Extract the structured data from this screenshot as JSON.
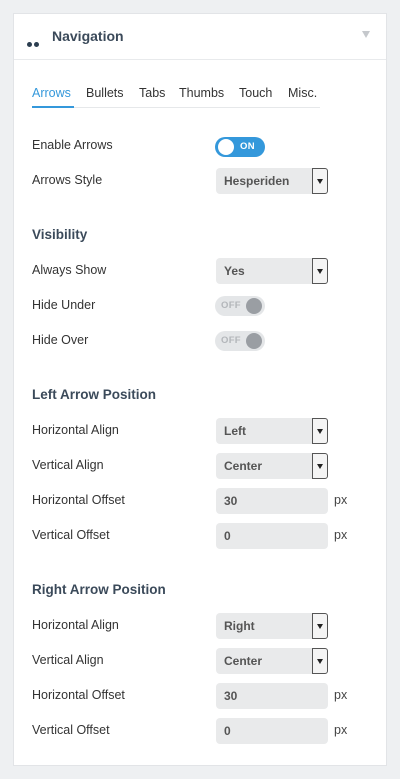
{
  "header": {
    "title": "Navigation"
  },
  "tabs": [
    "Arrows",
    "Bullets",
    "Tabs",
    "Thumbs",
    "Touch",
    "Misc."
  ],
  "arrows": {
    "enable_label": "Enable Arrows",
    "enable_state": "ON",
    "style_label": "Arrows Style",
    "style_value": "Hesperiden"
  },
  "visibility": {
    "title": "Visibility",
    "always_show_label": "Always Show",
    "always_show_value": "Yes",
    "hide_under_label": "Hide Under",
    "hide_under_state": "OFF",
    "hide_over_label": "Hide Over",
    "hide_over_state": "OFF"
  },
  "left_arrow": {
    "title": "Left Arrow Position",
    "h_align_label": "Horizontal Align",
    "h_align_value": "Left",
    "v_align_label": "Vertical Align",
    "v_align_value": "Center",
    "h_offset_label": "Horizontal Offset",
    "h_offset_value": "30",
    "v_offset_label": "Vertical Offset",
    "v_offset_value": "0",
    "unit": "px"
  },
  "right_arrow": {
    "title": "Right Arrow Position",
    "h_align_label": "Horizontal Align",
    "h_align_value": "Right",
    "v_align_label": "Vertical Align",
    "v_align_value": "Center",
    "h_offset_label": "Horizontal Offset",
    "h_offset_value": "30",
    "v_offset_label": "Vertical Offset",
    "v_offset_value": "0",
    "unit": "px"
  },
  "colors": {
    "accent": "#3498db",
    "title": "#3b4a5a"
  }
}
